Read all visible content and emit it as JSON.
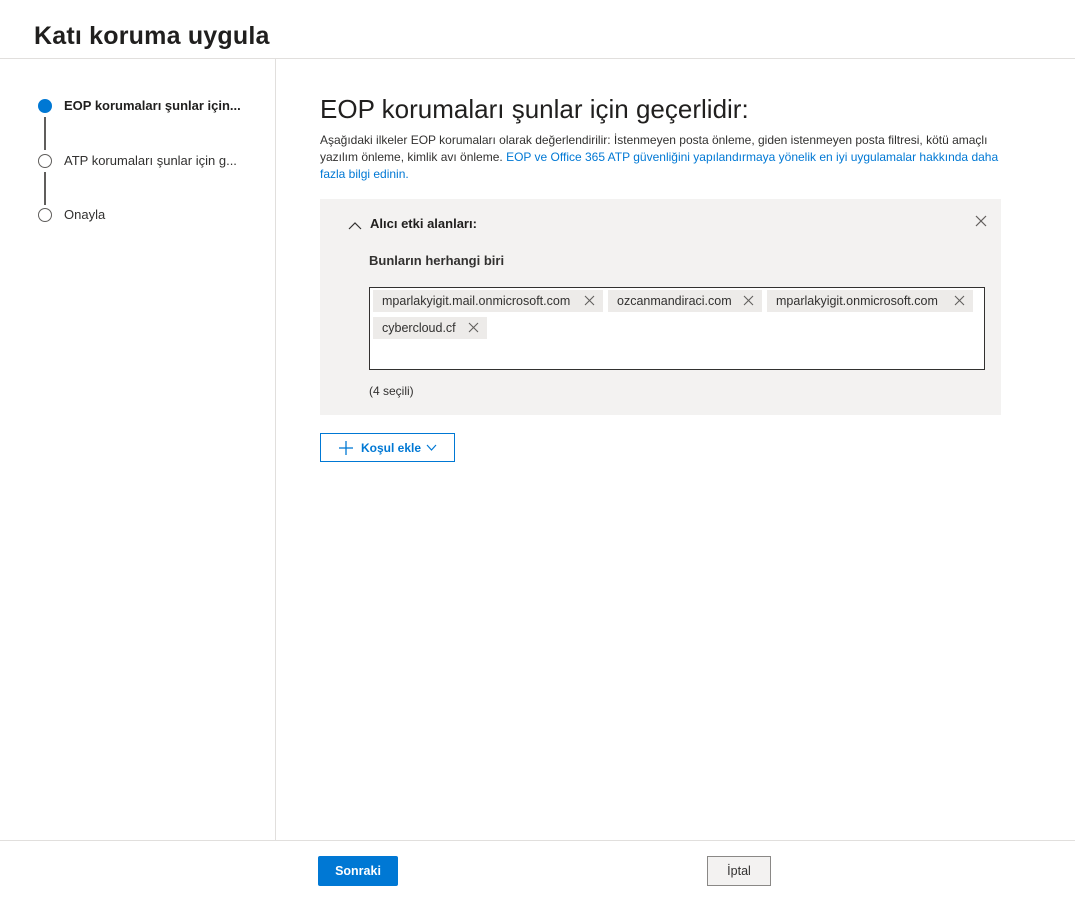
{
  "header": {
    "title": "Katı koruma uygula"
  },
  "steps": [
    {
      "label": "EOP korumaları şunlar için...",
      "active": true
    },
    {
      "label": "ATP korumaları şunlar için g...",
      "active": false
    },
    {
      "label": "Onayla",
      "active": false
    }
  ],
  "main": {
    "title": "EOP korumaları şunlar için geçerlidir:",
    "description": "Aşağıdaki ilkeler EOP korumaları olarak değerlendirilir: İstenmeyen posta önleme, giden istenmeyen posta filtresi, kötü amaçlı yazılım önleme, kimlik avı önleme. ",
    "link_text": "EOP ve Office 365 ATP güvenliğini yapılandırmaya yönelik en iyi uygulamalar hakkında daha fazla bilgi edinin."
  },
  "condition": {
    "title": "Alıcı etki alanları:",
    "subtitle": "Bunların herhangi biri",
    "tags": [
      "mparlakyigit.mail.onmicrosoft.com",
      "ozcanmandiraci.com",
      "mparlakyigit.onmicrosoft.com",
      "cybercloud.cf"
    ],
    "selected_count": "(4 seçili)"
  },
  "add_condition_label": "Koşul ekle",
  "footer": {
    "next_label": "Sonraki",
    "cancel_label": "İptal"
  },
  "colors": {
    "accent": "#0078d4",
    "panel_bg": "#f3f2f1",
    "tag_bg": "#edebe9"
  }
}
